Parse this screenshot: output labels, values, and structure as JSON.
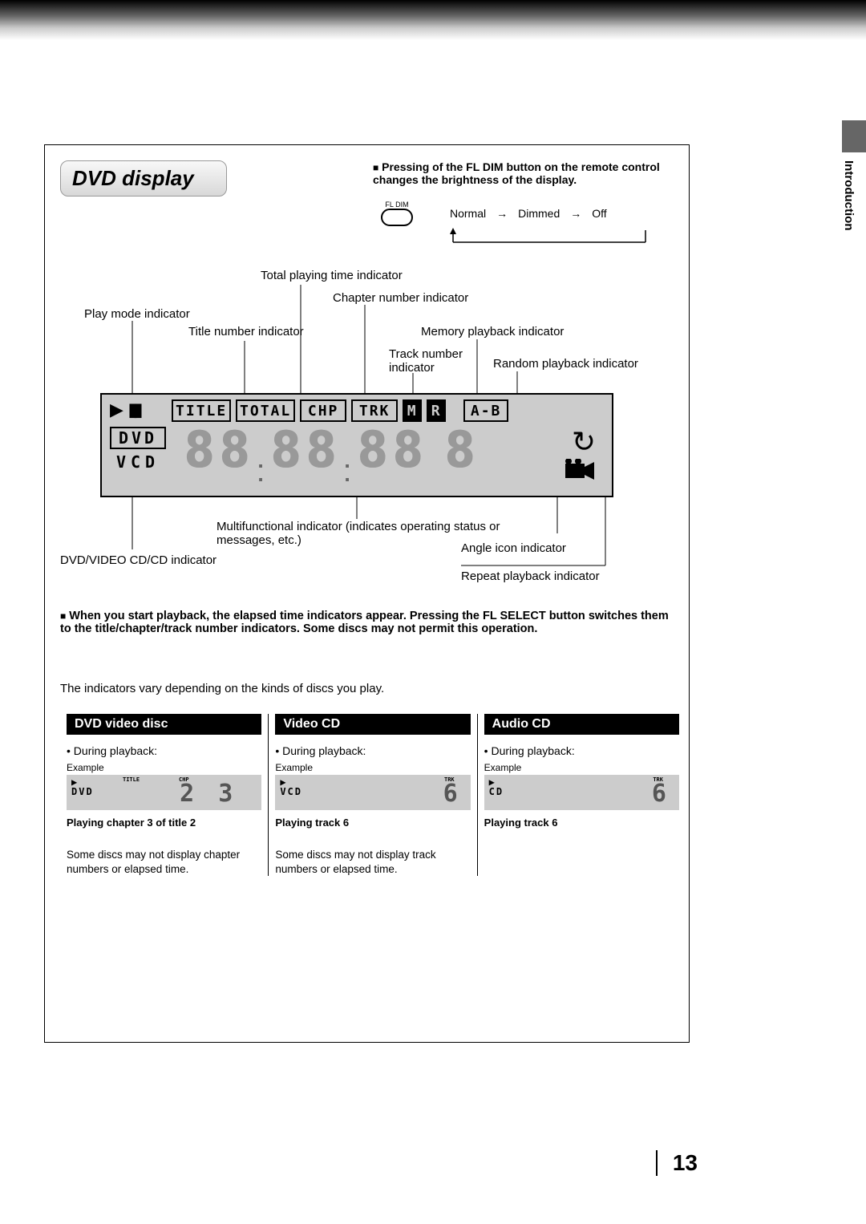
{
  "section_tab": "Introduction",
  "title": "DVD display",
  "fldim_note": "Pressing of the FL DIM button on the remote control changes the brightness of the display.",
  "fldim": {
    "button_label": "FL DIM",
    "state1": "Normal",
    "state2": "Dimmed",
    "state3": "Off"
  },
  "callouts_top": {
    "total_playing_time": "Total playing time indicator",
    "chapter_number": "Chapter number indicator",
    "play_mode": "Play mode indicator",
    "title_number": "Title number indicator",
    "memory_playback": "Memory playback indicator",
    "track_number": "Track number indicator",
    "random_playback": "Random playback indicator"
  },
  "display_labels": {
    "title": "TITLE",
    "total": "TOTAL",
    "chp": "CHP",
    "trk": "TRK",
    "m": "M",
    "r": "R",
    "ab": "A-B",
    "dvd": "DVD",
    "vcd": "VCD"
  },
  "callouts_bottom": {
    "multifunctional": "Multifunctional indicator (indicates operating status or messages, etc.)",
    "dvd_cd": "DVD/VIDEO CD/CD indicator",
    "angle": "Angle icon indicator",
    "repeat": "Repeat playback indicator"
  },
  "note2": "When you start playback, the elapsed time indicators appear.  Pressing the FL SELECT button switches them to the title/chapter/track number indicators. Some discs may not permit this operation.",
  "vary_note": "The indicators vary depending on the kinds of discs you play.",
  "columns": {
    "dvd": {
      "header": "DVD video disc",
      "during": "During playback:",
      "example": "Example",
      "mode": "DVD",
      "label_title": "TITLE",
      "label_chp": "CHP",
      "digits": "2 3",
      "caption": "Playing chapter 3 of title 2",
      "note": "Some discs may not display chapter numbers or elapsed time."
    },
    "vcd": {
      "header": "Video CD",
      "during": "During playback:",
      "example": "Example",
      "mode": "VCD",
      "label_trk": "TRK",
      "digits": "6",
      "caption": "Playing track 6",
      "note": "Some discs may not display track numbers or elapsed time."
    },
    "cd": {
      "header": "Audio CD",
      "during": "During playback:",
      "example": "Example",
      "mode": "CD",
      "label_trk": "TRK",
      "digits": "6",
      "caption": "Playing track 6"
    }
  },
  "page_number": "13"
}
